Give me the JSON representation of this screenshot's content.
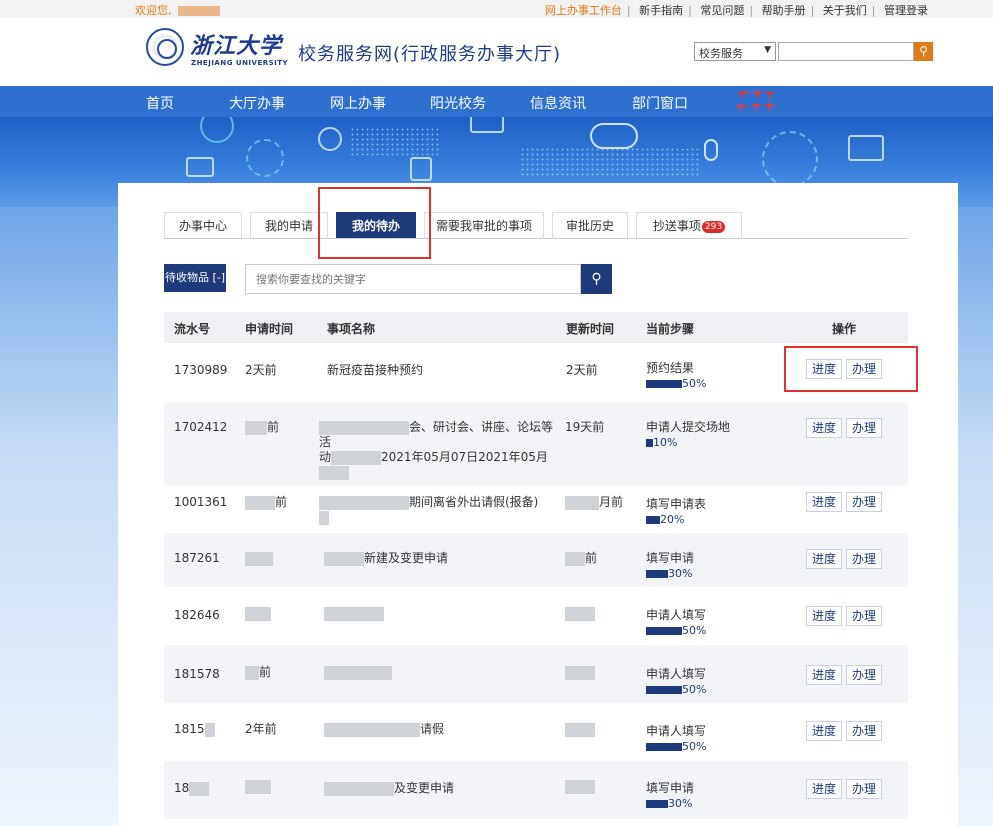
{
  "topbar": {
    "welcome": "欢迎您,",
    "links": [
      "网上办事工作台",
      "新手指南",
      "常见问题",
      "帮助手册",
      "关于我们",
      "管理登录"
    ]
  },
  "header": {
    "logo_cn": "浙江大学",
    "logo_en": "ZHEJIANG UNIVERSITY",
    "site_title": "校务服务网(行政服务办事大厅)",
    "search_select": "校务服务",
    "search_icon": "search-icon"
  },
  "nav": {
    "items": [
      "首页",
      "大厅办事",
      "网上办事",
      "阳光校务",
      "信息资讯",
      "部门窗口"
    ]
  },
  "tabs": [
    {
      "label": "办事中心"
    },
    {
      "label": "我的申请"
    },
    {
      "label": "我的待办"
    },
    {
      "label": "需要我审批的事项"
    },
    {
      "label": "审批历史"
    },
    {
      "label": "抄送事项",
      "badge": "293"
    }
  ],
  "toolbar": {
    "pickup_label": "待收物品",
    "search_placeholder": "搜索你要查找的关键字"
  },
  "table": {
    "headers": [
      "流水号",
      "申请时间",
      "事项名称",
      "更新时间",
      "当前步骤",
      "操作"
    ],
    "rows": [
      {
        "id": "1730989",
        "apply": "2天前",
        "name": "新冠疫苗接种预约",
        "name2": "",
        "update": "2天前",
        "step": "预约结果",
        "pct": "50%",
        "frac": 0.5
      },
      {
        "id": "1702412",
        "apply": "前",
        "name": "会、研讨会、讲座、论坛等活",
        "name2": "2021年05月07日2021年05月",
        "update": "19天前",
        "step": "申请人提交场地",
        "pct": "10%",
        "frac": 0.1
      },
      {
        "id": "1001361",
        "apply": "前",
        "name": "期间离省外出请假(报备)",
        "name2": "",
        "update": "月前",
        "step": "填写申请表",
        "pct": "20%",
        "frac": 0.2
      },
      {
        "id": "187261",
        "apply": "",
        "name": "新建及变更申请",
        "name2": "",
        "update": "前",
        "step": "填写申请",
        "pct": "30%",
        "frac": 0.3
      },
      {
        "id": "182646",
        "apply": "",
        "name": "",
        "name2": "",
        "update": "",
        "step": "申请人填写",
        "pct": "50%",
        "frac": 0.5
      },
      {
        "id": "181578",
        "apply": "前",
        "name": "",
        "name2": "",
        "update": "",
        "step": "申请人填写",
        "pct": "50%",
        "frac": 0.5
      },
      {
        "id": "1815",
        "apply": "2年前",
        "name": "请假",
        "name2": "",
        "update": "",
        "step": "申请人填写",
        "pct": "50%",
        "frac": 0.5
      },
      {
        "id": "18",
        "apply": "",
        "name": "及变更申请",
        "name2": "",
        "update": "",
        "step": "填写申请",
        "pct": "30%",
        "frac": 0.3
      }
    ],
    "progress_label": "进度",
    "handle_label": "办理"
  }
}
